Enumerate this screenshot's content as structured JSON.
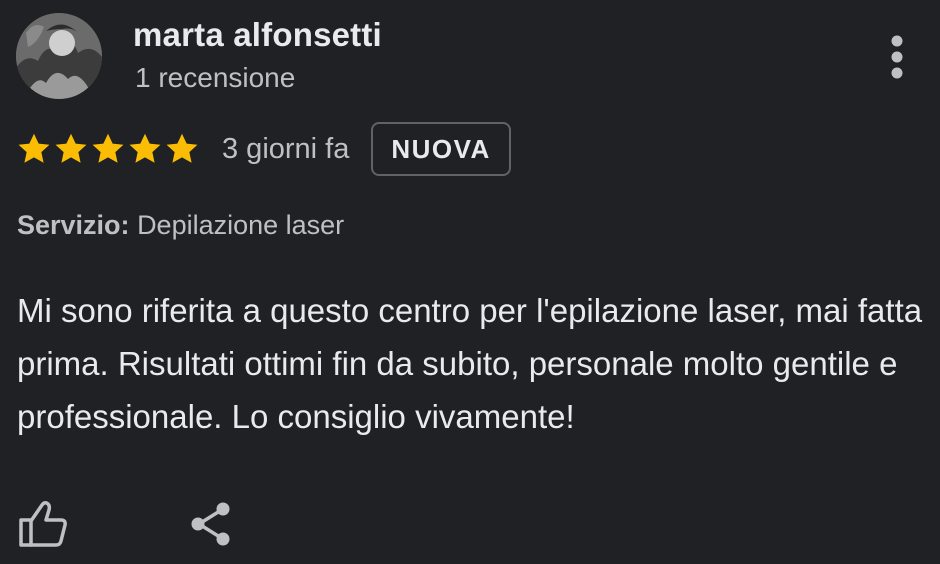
{
  "review": {
    "author": {
      "name": "marta alfonsetti",
      "meta": "1 recensione",
      "avatar_icon": "profile-photo"
    },
    "menu_icon": "more-vert-icon",
    "rating": {
      "stars": 5,
      "max_stars": 5,
      "star_color": "#fbbc04"
    },
    "time": "3 giorni fa",
    "badge": "NUOVA",
    "service": {
      "label": "Servizio:",
      "value": "Depilazione laser"
    },
    "text": "Mi sono riferita a questo centro per l'epilazione laser, mai fatta prima. Risultati ottimi fin da subito, personale molto gentile e professionale. Lo consiglio vivamente!",
    "actions": {
      "like_icon": "thumbs-up-icon",
      "share_icon": "share-icon"
    }
  },
  "colors": {
    "background": "#202124",
    "primary_text": "#e8eaed",
    "secondary_text": "#bdc1c6",
    "badge_border": "#5f6368",
    "star": "#fbbc04"
  }
}
